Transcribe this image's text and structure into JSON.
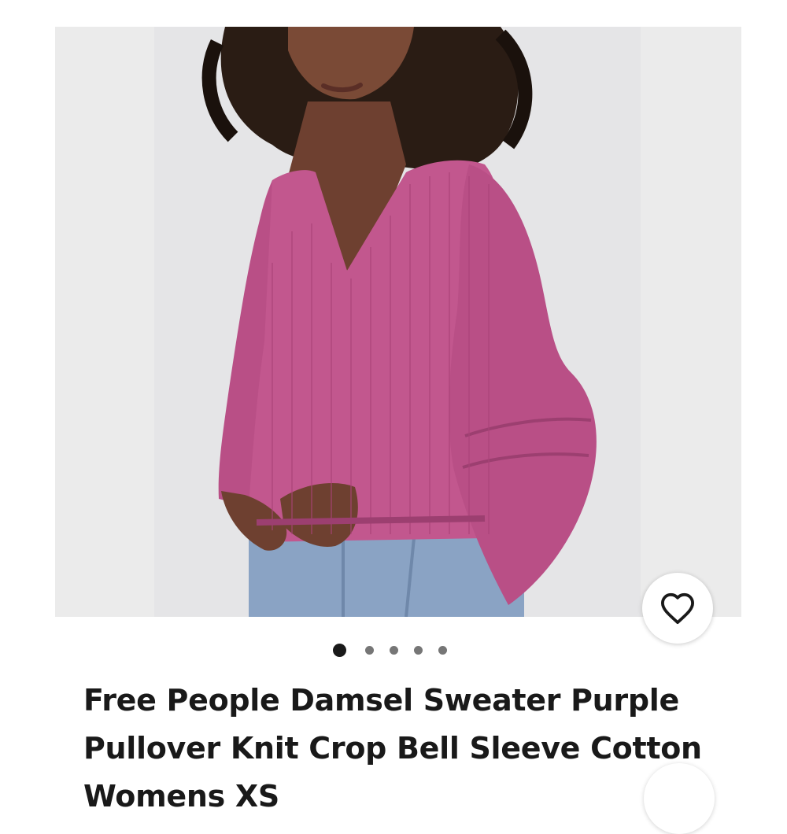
{
  "listing": {
    "title": "Free People Damsel Sweater Purple Pullover Knit Crop Bell Sleeve Cotton Womens XS",
    "image_alt": "Woman wearing a pink bell sleeve cropped knit sweater with jeans"
  },
  "gallery": {
    "image_count": 5,
    "active_index": 0
  },
  "icons": {
    "favorite": "heart-outline-icon",
    "share": "share-icon"
  },
  "colors": {
    "sweater": "#c2578e",
    "accent_dark": "#191919",
    "dot_inactive": "#767676"
  }
}
